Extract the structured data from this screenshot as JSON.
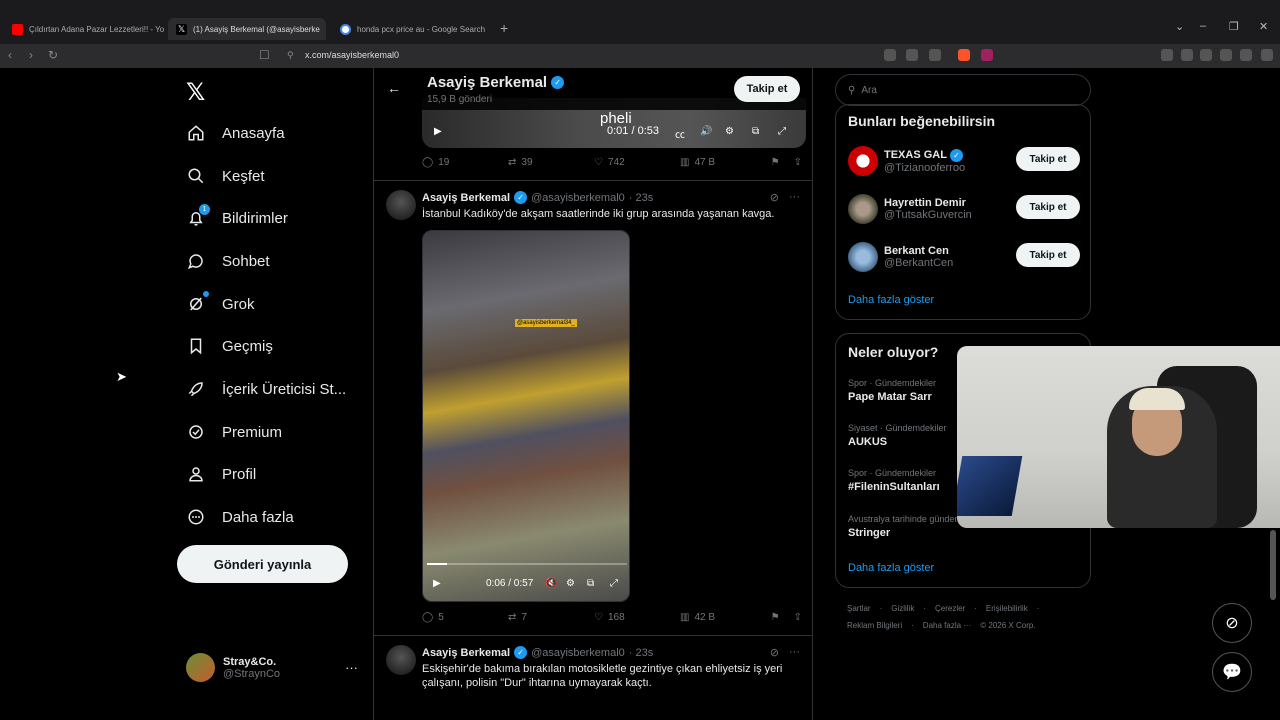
{
  "browser": {
    "tabs": [
      {
        "title": "Çıldırtan Adana Pazar Lezzetleri!! - Yo",
        "favicon_color": "#ff0000"
      },
      {
        "title": "(1) Asayiş Berkemal (@asayisberke",
        "favicon_color": "#ffffff"
      },
      {
        "title": "honda pcx price au - Google Search",
        "favicon_color": "#4285f4"
      }
    ],
    "url": "x.com/asayisberkemal0",
    "new_tab": "+",
    "tab_close": "×"
  },
  "nav": {
    "logo": "𝕏",
    "items": [
      {
        "label": "Anasayfa",
        "icon": "home-icon"
      },
      {
        "label": "Keşfet",
        "icon": "search-icon"
      },
      {
        "label": "Bildirimler",
        "icon": "bell-icon",
        "badge": "1"
      },
      {
        "label": "Sohbet",
        "icon": "chat-icon"
      },
      {
        "label": "Grok",
        "icon": "grok-icon"
      },
      {
        "label": "Geçmiş",
        "icon": "bookmark-icon"
      },
      {
        "label": "İçerik Üreticisi St...",
        "icon": "rocket-icon"
      },
      {
        "label": "Premium",
        "icon": "premium-icon"
      },
      {
        "label": "Profil",
        "icon": "person-icon"
      },
      {
        "label": "Daha fazla",
        "icon": "more-circle-icon"
      }
    ],
    "post_button": "Gönderi yayınla",
    "account": {
      "name": "Stray&Co.",
      "handle": "@StraynCo",
      "more": "···"
    }
  },
  "header": {
    "name": "Asayiş Berkemal",
    "post_count": "15,9 B gönderi",
    "follow": "Takip et"
  },
  "top_video": {
    "watermark": "pheli",
    "time": "0:01 / 0:53"
  },
  "tweets": [
    {
      "actions": {
        "replies": "19",
        "reposts": "39",
        "likes": "742",
        "views": "47 B"
      }
    },
    {
      "name": "Asayiş Berkemal",
      "handle": "@asayisberkemal0",
      "time": "· 23s",
      "text": "İstanbul Kadıköy'de akşam saatlerinde iki grup arasında yaşanan kavga.",
      "video_tag": "@asayisberkemal34_",
      "video_time": "0:06 / 0:57",
      "video_progress": 0.1,
      "actions": {
        "replies": "5",
        "reposts": "7",
        "likes": "168",
        "views": "42 B"
      }
    },
    {
      "name": "Asayiş Berkemal",
      "handle": "@asayisberkemal0",
      "time": "· 23s",
      "text": "Eskişehir'de bakıma bırakılan motosikletle gezintiye çıkan ehliyetsiz iş yeri çalışanı, polisin \"Dur\" ihtarına uymayarak kaçtı."
    }
  ],
  "sidebar": {
    "search_placeholder": "Ara",
    "suggestions_title": "Bunları beğenebilirsin",
    "suggestions": [
      {
        "name": "TEXAS GAL",
        "handle": "@Tizianooferroo",
        "verified": true,
        "button": "Takip et"
      },
      {
        "name": "Hayrettin Demir",
        "handle": "@TutsakGuvercin",
        "verified": false,
        "button": "Takip et"
      },
      {
        "name": "Berkant Cen",
        "handle": "@BerkantCen",
        "verified": false,
        "button": "Takip et"
      }
    ],
    "show_more": "Daha fazla göster",
    "trends_title": "Neler oluyor?",
    "trends": [
      {
        "category": "Spor · Gündemdekiler",
        "name": "Pape Matar Sarr"
      },
      {
        "category": "Siyaset · Gündemdekiler",
        "name": "AUKUS"
      },
      {
        "category": "Spor · Gündemdekiler",
        "name": "#FileninSultanları"
      },
      {
        "category": "Avustralya tarihinde gündem",
        "name": "Stringer"
      }
    ],
    "trends_more": "Daha fazla göster",
    "footer1": [
      "Şartlar",
      "·",
      "Gizlilik",
      "·",
      "Çerezler",
      "·",
      "Erişilebilirlik",
      "·"
    ],
    "footer2": [
      "Reklam Bilgileri",
      "·",
      "Daha fazla ···",
      "© 2026 X Corp."
    ]
  },
  "colors": {
    "accent": "#1d9bf0",
    "background": "#000000",
    "border": "#2f3336",
    "muted": "#71767b"
  }
}
